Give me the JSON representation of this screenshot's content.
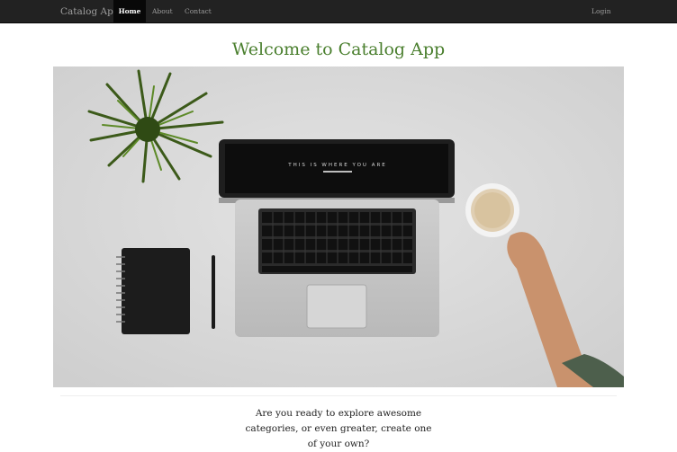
{
  "navbar": {
    "brand": "Catalog App",
    "items": [
      {
        "label": "Home",
        "active": true
      },
      {
        "label": "About",
        "active": false
      },
      {
        "label": "Contact",
        "active": false
      }
    ],
    "login_label": "Login"
  },
  "main": {
    "title": "Welcome to Catalog App",
    "intro": "Are you ready to explore awesome categories, or even greater, create one of your own?"
  },
  "hero": {
    "laptop_screen_text": "THIS IS WHERE YOU ARE"
  },
  "colors": {
    "navbar_bg": "#222222",
    "title_green": "#4a7f2e",
    "desk_gray": "#dedede"
  }
}
